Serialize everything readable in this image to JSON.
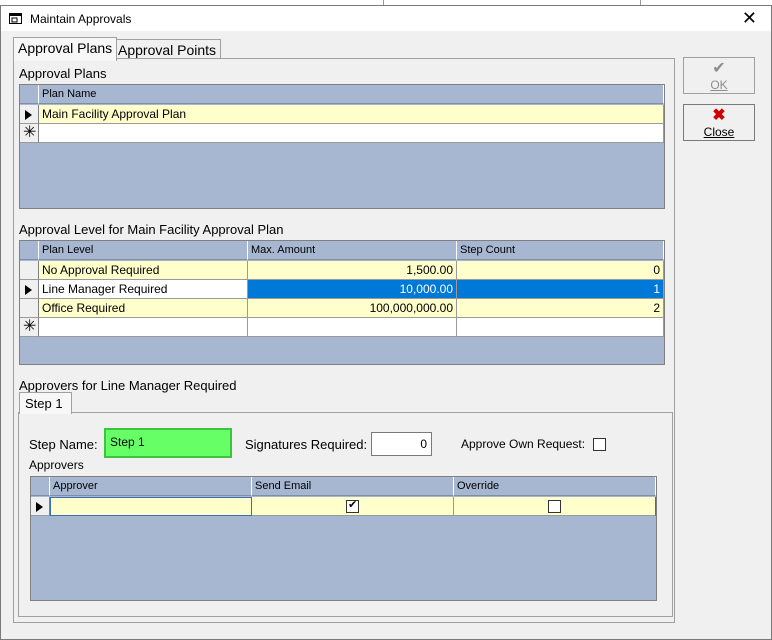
{
  "window": {
    "title": "Maintain Approvals"
  },
  "tabs": [
    {
      "label": "Approval Plans"
    },
    {
      "label": "Approval Points"
    }
  ],
  "plans": {
    "section_label": "Approval Plans",
    "column_header": "Plan Name",
    "rows": [
      {
        "name": "Main Facility Approval Plan"
      }
    ]
  },
  "levels": {
    "section_label": "Approval Level for Main Facility Approval Plan",
    "columns": [
      "Plan Level",
      "Max. Amount",
      "Step Count"
    ],
    "rows": [
      {
        "level": "No Approval Required",
        "max_amount": "1,500.00",
        "step_count": "0"
      },
      {
        "level": "Line Manager Required",
        "max_amount": "10,000.00",
        "step_count": "1"
      },
      {
        "level": "Office Required",
        "max_amount": "100,000,000.00",
        "step_count": "2"
      }
    ]
  },
  "approvers_section": {
    "section_label": "Approvers for Line Manager Required",
    "step_tab": "Step 1",
    "step_name_label": "Step Name:",
    "step_name_value": "Step 1",
    "signatures_label": "Signatures Required:",
    "signatures_value": "0",
    "approve_own_label": "Approve Own Request:",
    "approve_own_checked": false,
    "approvers_label": "Approvers",
    "columns": [
      "Approver",
      "Send Email",
      "Override"
    ],
    "rows": [
      {
        "approver": "",
        "send_email": true,
        "override": false
      }
    ]
  },
  "buttons": {
    "ok": "OK",
    "close": "Close"
  },
  "icons": {
    "window": "window-icon",
    "ok": "checkmark-icon",
    "close": "red-x-icon"
  },
  "colors": {
    "grid_bg": "#a7b7d1",
    "row_yellow": "#ffffcc",
    "selection": "#0078d7",
    "step_name_bg": "#66ff66"
  }
}
